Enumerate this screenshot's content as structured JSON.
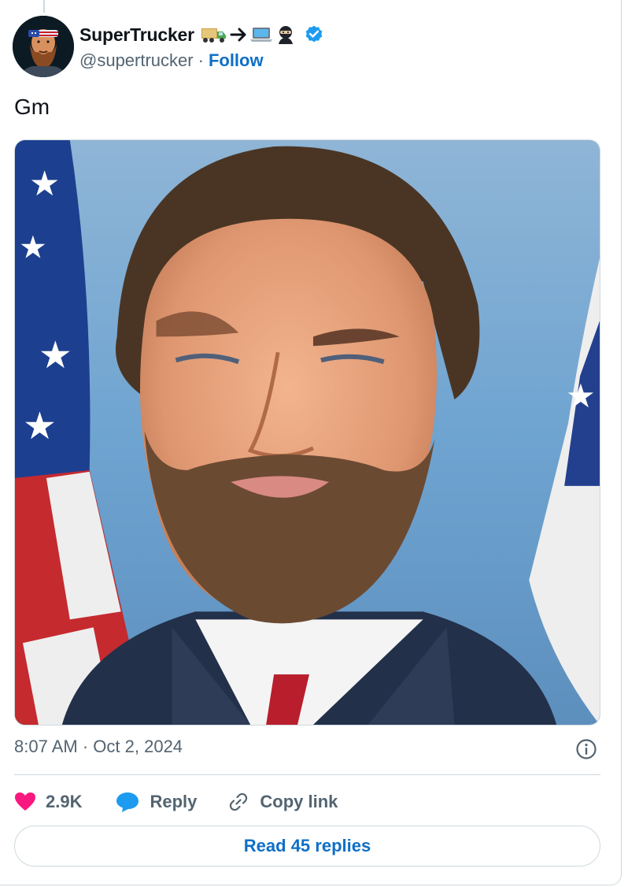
{
  "author": {
    "display_name": "SuperTrucker",
    "handle": "@supertrucker",
    "separator": "·",
    "follow_label": "Follow",
    "name_emojis": [
      "truck-icon",
      "arrow-right-icon",
      "laptop-icon",
      "ninja-icon"
    ],
    "verified": true,
    "avatar": "bearded-man-headband-avatar"
  },
  "tweet": {
    "text": "Gm",
    "media": "portrait-man-beard-flags-image",
    "time": "8:07 AM",
    "separator": "·",
    "date": "Oct 2, 2024"
  },
  "actions": {
    "likes_count": "2.9K",
    "reply_label": "Reply",
    "copy_link_label": "Copy link"
  },
  "footer": {
    "read_replies_label": "Read 45 replies"
  },
  "colors": {
    "link_blue": "#0f6fc6",
    "verified_blue": "#1d9bf0",
    "like_pink": "#f91880",
    "secondary_text": "#536471",
    "border": "#cfd9de"
  }
}
